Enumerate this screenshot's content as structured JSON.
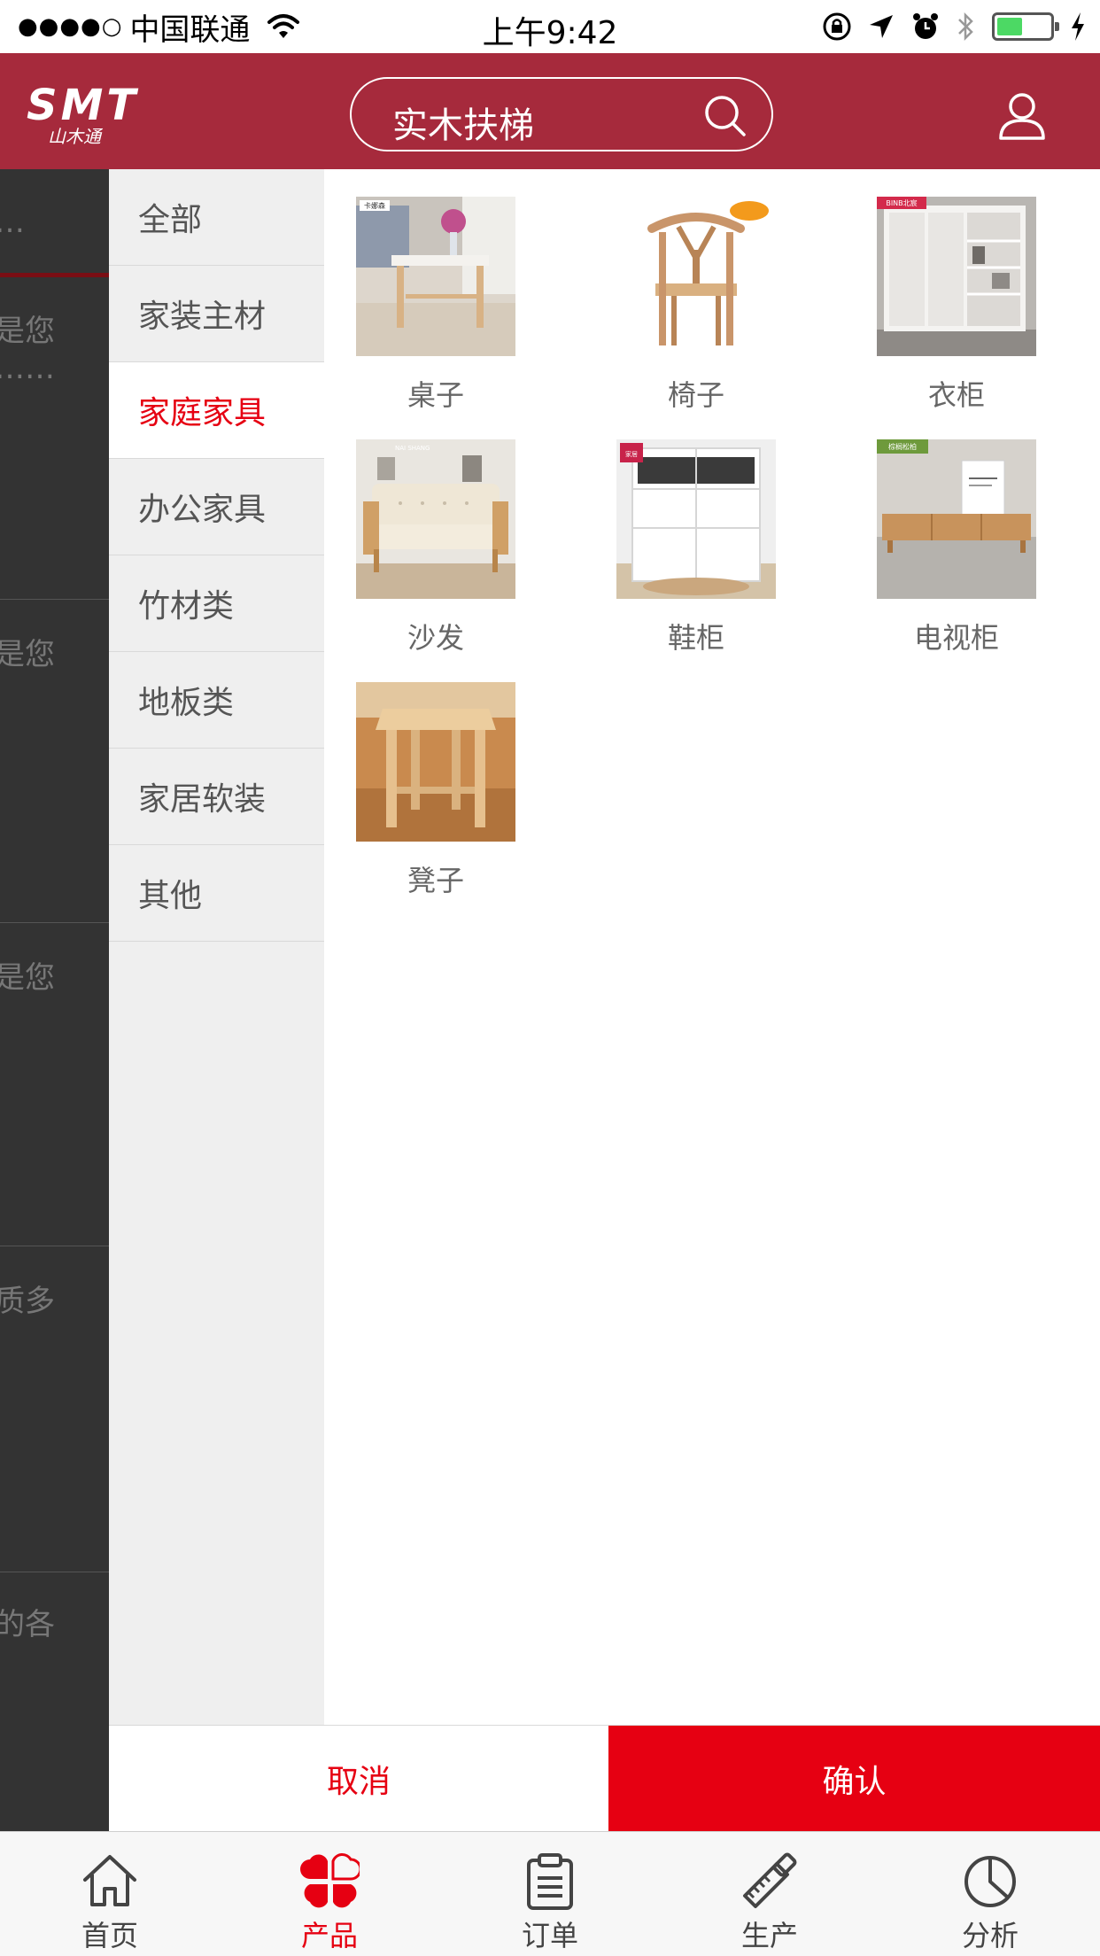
{
  "status_bar": {
    "signal": "●●●●○",
    "carrier": "中国联通",
    "time": "上午9:42"
  },
  "header": {
    "logo_text": "SMT",
    "logo_subtext": "山木通",
    "search_value": "实木扶梯",
    "search_icon": "search-icon",
    "user_icon": "user-icon"
  },
  "background_page": {
    "items": [
      "…",
      "是您",
      "……",
      "是您",
      "是您",
      "质多",
      "的各"
    ]
  },
  "categories": [
    {
      "label": "全部",
      "active": false
    },
    {
      "label": "家装主材",
      "active": false
    },
    {
      "label": "家庭家具",
      "active": true
    },
    {
      "label": "办公家具",
      "active": false
    },
    {
      "label": "竹材类",
      "active": false
    },
    {
      "label": "地板类",
      "active": false
    },
    {
      "label": "家居软装",
      "active": false
    },
    {
      "label": "其他",
      "active": false
    }
  ],
  "products": [
    {
      "name": "桌子",
      "badge": "卡娜森"
    },
    {
      "name": "椅子",
      "badge": ""
    },
    {
      "name": "衣柜",
      "badge": "BINB北宸"
    },
    {
      "name": "沙发",
      "badge": "NAI SHANG"
    },
    {
      "name": "鞋柜",
      "badge": "家居"
    },
    {
      "name": "电视柜",
      "badge": "棕榈松柏"
    },
    {
      "name": "凳子",
      "badge": ""
    }
  ],
  "actions": {
    "cancel_label": "取消",
    "confirm_label": "确认"
  },
  "colors": {
    "header": "#a62a3c",
    "accent": "#e60012",
    "sidebar_bg": "#efefef",
    "overlay": "#333333"
  },
  "tabs": [
    {
      "label": "首页",
      "icon": "home-icon",
      "active": false
    },
    {
      "label": "产品",
      "icon": "product-icon",
      "active": true
    },
    {
      "label": "订单",
      "icon": "clipboard-icon",
      "active": false
    },
    {
      "label": "生产",
      "icon": "saw-icon",
      "active": false
    },
    {
      "label": "分析",
      "icon": "pie-chart-icon",
      "active": false
    }
  ]
}
